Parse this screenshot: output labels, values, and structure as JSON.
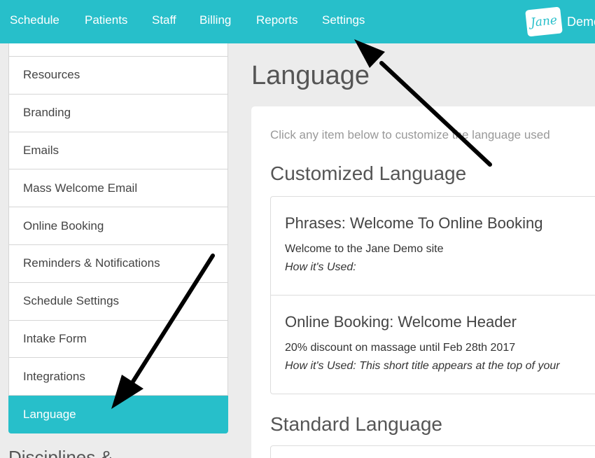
{
  "nav": {
    "items": [
      {
        "label": "Schedule"
      },
      {
        "label": "Patients"
      },
      {
        "label": "Staff"
      },
      {
        "label": "Billing"
      },
      {
        "label": "Reports"
      },
      {
        "label": "Settings"
      }
    ],
    "brand_logo": "Jane",
    "brand_text": "Demo"
  },
  "sidebar": {
    "items": [
      {
        "label": "Resources"
      },
      {
        "label": "Branding"
      },
      {
        "label": "Emails"
      },
      {
        "label": "Mass Welcome Email"
      },
      {
        "label": "Online Booking"
      },
      {
        "label": "Reminders & Notifications"
      },
      {
        "label": "Schedule Settings"
      },
      {
        "label": "Intake Form"
      },
      {
        "label": "Integrations"
      },
      {
        "label": "Language",
        "active": true
      }
    ],
    "below_heading": "Disciplines &"
  },
  "main": {
    "title": "Language",
    "intro": "Click any item below to customize the language used",
    "customized_heading": "Customized Language",
    "customized": [
      {
        "title": "Phrases: Welcome To Online Booking",
        "value": "Welcome to the Jane Demo site",
        "usage": "How it's Used:"
      },
      {
        "title": "Online Booking: Welcome Header",
        "value": "20% discount on massage until Feb 28th 2017",
        "usage": "How it's Used: This short title appears at the top of your"
      }
    ],
    "standard_heading": "Standard Language"
  },
  "colors": {
    "brand": "#27bfca",
    "background": "#ececec",
    "annotation_arrow": "#000000"
  }
}
